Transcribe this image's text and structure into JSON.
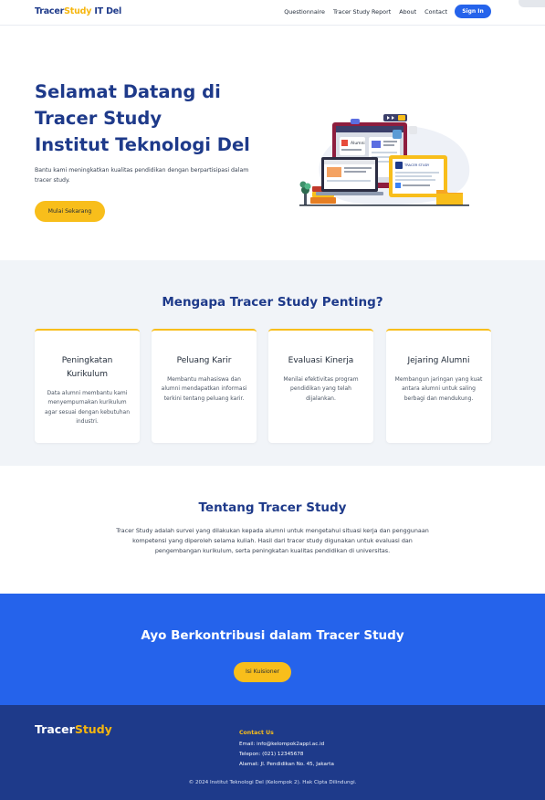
{
  "header": {
    "logo_part1": "Tracer",
    "logo_part2": "Study",
    "logo_part3": " IT Del",
    "nav": [
      "Questionnaire",
      "Tracer Study Report",
      "About",
      "Contact"
    ],
    "signin_label": "Sign In"
  },
  "hero": {
    "title_lines": [
      "Selamat Datang di",
      "Tracer Study",
      "Institut Teknologi Del"
    ],
    "subtitle": "Bantu kami meningkatkan kualitas pendidikan dengan berpartisipasi dalam tracer study.",
    "cta_label": "Mulai Sekarang",
    "illustration_labels": {
      "alumni": "Alumni",
      "tracer": "TRACER STUDY"
    }
  },
  "why": {
    "title": "Mengapa Tracer Study Penting?",
    "cards": [
      {
        "title": "Peningkatan Kurikulum",
        "text": "Data alumni membantu kami menyempurnakan kurikulum agar sesuai dengan kebutuhan industri."
      },
      {
        "title": "Peluang Karir",
        "text": "Membantu mahasiswa dan alumni mendapatkan informasi terkini tentang peluang karir."
      },
      {
        "title": "Evaluasi Kinerja",
        "text": "Menilai efektivitas program pendidikan yang telah dijalankan."
      },
      {
        "title": "Jejaring Alumni",
        "text": "Membangun jaringan yang kuat antara alumni untuk saling berbagi dan mendukung."
      }
    ]
  },
  "about": {
    "title": "Tentang Tracer Study",
    "text": "Tracer Study adalah survei yang dilakukan kepada alumni untuk mengetahui situasi kerja dan penggunaan kompetensi yang diperoleh selama kuliah. Hasil dari tracer study digunakan untuk evaluasi dan pengembangan kurikulum, serta peningkatan kualitas pendidikan di universitas."
  },
  "cta": {
    "title": "Ayo Berkontribusi dalam Tracer Study",
    "button_label": "Isi Kuisioner"
  },
  "footer": {
    "logo_part1": "Tracer",
    "logo_part2": "Study",
    "contact_title": "Contact Us",
    "email": "Email: info@kelompok2appl.ac.id",
    "phone": "Telepon: (021) 12345678",
    "address": "Alamat: Jl. Pendidikan No. 45, Jakarta",
    "copyright": "© 2024 Institut Teknologi Del (Kelompok 2). Hak Cipta Dilindungi."
  },
  "colors": {
    "primary_dark": "#1e3a8a",
    "primary": "#2563eb",
    "accent": "#f8be1b",
    "section_bg": "#f1f4f8"
  }
}
